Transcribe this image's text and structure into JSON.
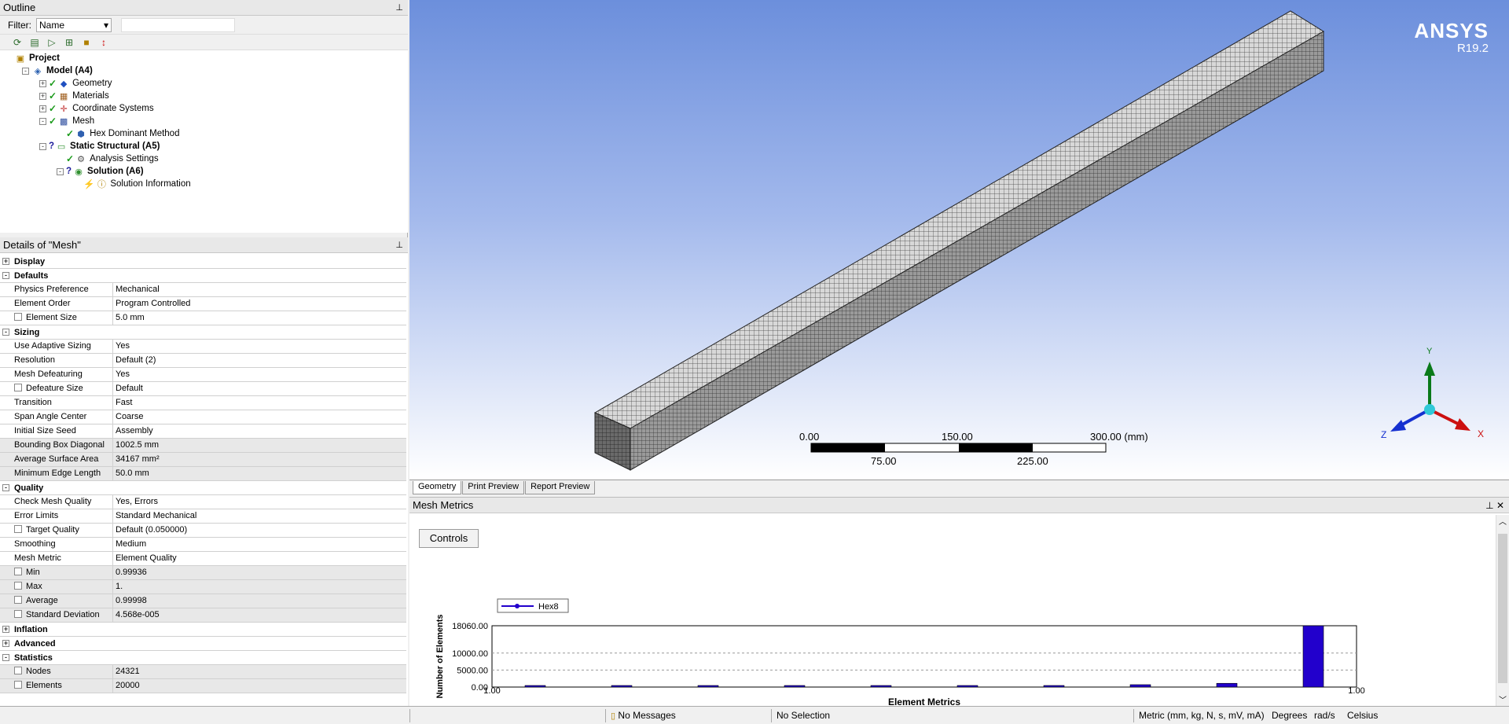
{
  "outline": {
    "title": "Outline",
    "filter_label": "Filter:",
    "filter_value": "Name",
    "tree": [
      {
        "label": "Project",
        "bold": true,
        "indent": 0,
        "icon": "project-icon",
        "exp": ""
      },
      {
        "label": "Model (A4)",
        "bold": true,
        "indent": 1,
        "icon": "model-icon",
        "exp": "-"
      },
      {
        "label": "Geometry",
        "bold": false,
        "indent": 2,
        "icon": "geometry-icon",
        "exp": "+",
        "check": true
      },
      {
        "label": "Materials",
        "bold": false,
        "indent": 2,
        "icon": "materials-icon",
        "exp": "+",
        "check": true
      },
      {
        "label": "Coordinate Systems",
        "bold": false,
        "indent": 2,
        "icon": "coordinate-systems-icon",
        "exp": "+",
        "check": true
      },
      {
        "label": "Mesh",
        "bold": false,
        "indent": 2,
        "icon": "mesh-icon",
        "exp": "-",
        "check": true
      },
      {
        "label": "Hex Dominant Method",
        "bold": false,
        "indent": 3,
        "icon": "hex-method-icon",
        "exp": "",
        "check": true
      },
      {
        "label": "Static Structural (A5)",
        "bold": true,
        "indent": 2,
        "icon": "static-structural-icon",
        "exp": "-",
        "question": true
      },
      {
        "label": "Analysis Settings",
        "bold": false,
        "indent": 3,
        "icon": "analysis-settings-icon",
        "exp": "",
        "check": true
      },
      {
        "label": "Solution (A6)",
        "bold": true,
        "indent": 3,
        "icon": "solution-icon",
        "exp": "-",
        "question": true
      },
      {
        "label": "Solution Information",
        "bold": false,
        "indent": 4,
        "icon": "solution-information-icon",
        "exp": "",
        "lightning": true
      }
    ]
  },
  "details": {
    "title": "Details of \"Mesh\"",
    "rows": [
      {
        "type": "section",
        "label": "Display",
        "exp": "+"
      },
      {
        "type": "section",
        "label": "Defaults",
        "exp": "-"
      },
      {
        "type": "row",
        "k": "Physics Preference",
        "v": "Mechanical"
      },
      {
        "type": "row",
        "k": "Element Order",
        "v": "Program Controlled"
      },
      {
        "type": "row",
        "k": "Element Size",
        "v": "5.0 mm",
        "cb": true
      },
      {
        "type": "section",
        "label": "Sizing",
        "exp": "-"
      },
      {
        "type": "row",
        "k": "Use Adaptive Sizing",
        "v": "Yes"
      },
      {
        "type": "row",
        "k": "Resolution",
        "v": "Default (2)"
      },
      {
        "type": "row",
        "k": "Mesh Defeaturing",
        "v": "Yes"
      },
      {
        "type": "row",
        "k": "Defeature Size",
        "v": "Default",
        "cb": true
      },
      {
        "type": "row",
        "k": "Transition",
        "v": "Fast"
      },
      {
        "type": "row",
        "k": "Span Angle Center",
        "v": "Coarse"
      },
      {
        "type": "row",
        "k": "Initial Size Seed",
        "v": "Assembly"
      },
      {
        "type": "row",
        "k": "Bounding Box Diagonal",
        "v": "1002.5 mm",
        "gray": true
      },
      {
        "type": "row",
        "k": "Average Surface Area",
        "v": "34167 mm²",
        "gray": true
      },
      {
        "type": "row",
        "k": "Minimum Edge Length",
        "v": "50.0 mm",
        "gray": true
      },
      {
        "type": "section",
        "label": "Quality",
        "exp": "-"
      },
      {
        "type": "row",
        "k": "Check Mesh Quality",
        "v": "Yes, Errors"
      },
      {
        "type": "row",
        "k": "Error Limits",
        "v": "Standard Mechanical"
      },
      {
        "type": "row",
        "k": "Target Quality",
        "v": "Default (0.050000)",
        "cb": true
      },
      {
        "type": "row",
        "k": "Smoothing",
        "v": "Medium"
      },
      {
        "type": "row",
        "k": "Mesh Metric",
        "v": "Element Quality"
      },
      {
        "type": "row",
        "k": "Min",
        "v": "0.99936",
        "cb": true,
        "gray": true
      },
      {
        "type": "row",
        "k": "Max",
        "v": "1.",
        "cb": true,
        "gray": true
      },
      {
        "type": "row",
        "k": "Average",
        "v": "0.99998",
        "cb": true,
        "gray": true
      },
      {
        "type": "row",
        "k": "Standard Deviation",
        "v": "4.568e-005",
        "cb": true,
        "gray": true
      },
      {
        "type": "section",
        "label": "Inflation",
        "exp": "+"
      },
      {
        "type": "section",
        "label": "Advanced",
        "exp": "+"
      },
      {
        "type": "section",
        "label": "Statistics",
        "exp": "-"
      },
      {
        "type": "row",
        "k": "Nodes",
        "v": "24321",
        "cb": true,
        "gray": true
      },
      {
        "type": "row",
        "k": "Elements",
        "v": "20000",
        "cb": true,
        "gray": true
      }
    ]
  },
  "viewport": {
    "logo_main": "ANSYS",
    "logo_version": "R19.2",
    "scale_top": [
      "0.00",
      "150.00",
      "300.00 (mm)"
    ],
    "scale_bottom": [
      "75.00",
      "225.00"
    ],
    "axis_x": "X",
    "axis_y": "Y",
    "axis_z": "Z"
  },
  "tabs": [
    "Geometry",
    "Print Preview",
    "Report Preview"
  ],
  "metrics": {
    "title": "Mesh Metrics",
    "controls_label": "Controls",
    "legend": "Hex8",
    "ylabel": "Number of Elements",
    "xlabel": "Element Metrics",
    "x_min_label": "1.00",
    "x_max_label": "1.00",
    "yticks": [
      "18060.00",
      "10000.00",
      "5000.00",
      "0.00"
    ]
  },
  "chart_data": {
    "type": "bar",
    "title": "",
    "xlabel": "Element Metrics",
    "ylabel": "Number of Elements",
    "ylim": [
      0,
      18060
    ],
    "yticks": [
      0,
      5000,
      10000,
      18060
    ],
    "xtick_labels": [
      "1.00",
      "1.00"
    ],
    "series": [
      {
        "name": "Hex8",
        "color": "#2200cc",
        "values": [
          80,
          80,
          80,
          80,
          80,
          80,
          260,
          700,
          1100,
          18060
        ]
      }
    ],
    "legend": "top-left",
    "grid": true
  },
  "status": {
    "messages": "No Messages",
    "selection": "No Selection",
    "units": "Metric (mm, kg, N, s, mV, mA)",
    "angle": "Degrees",
    "rate": "rad/s",
    "temp": "Celsius"
  }
}
